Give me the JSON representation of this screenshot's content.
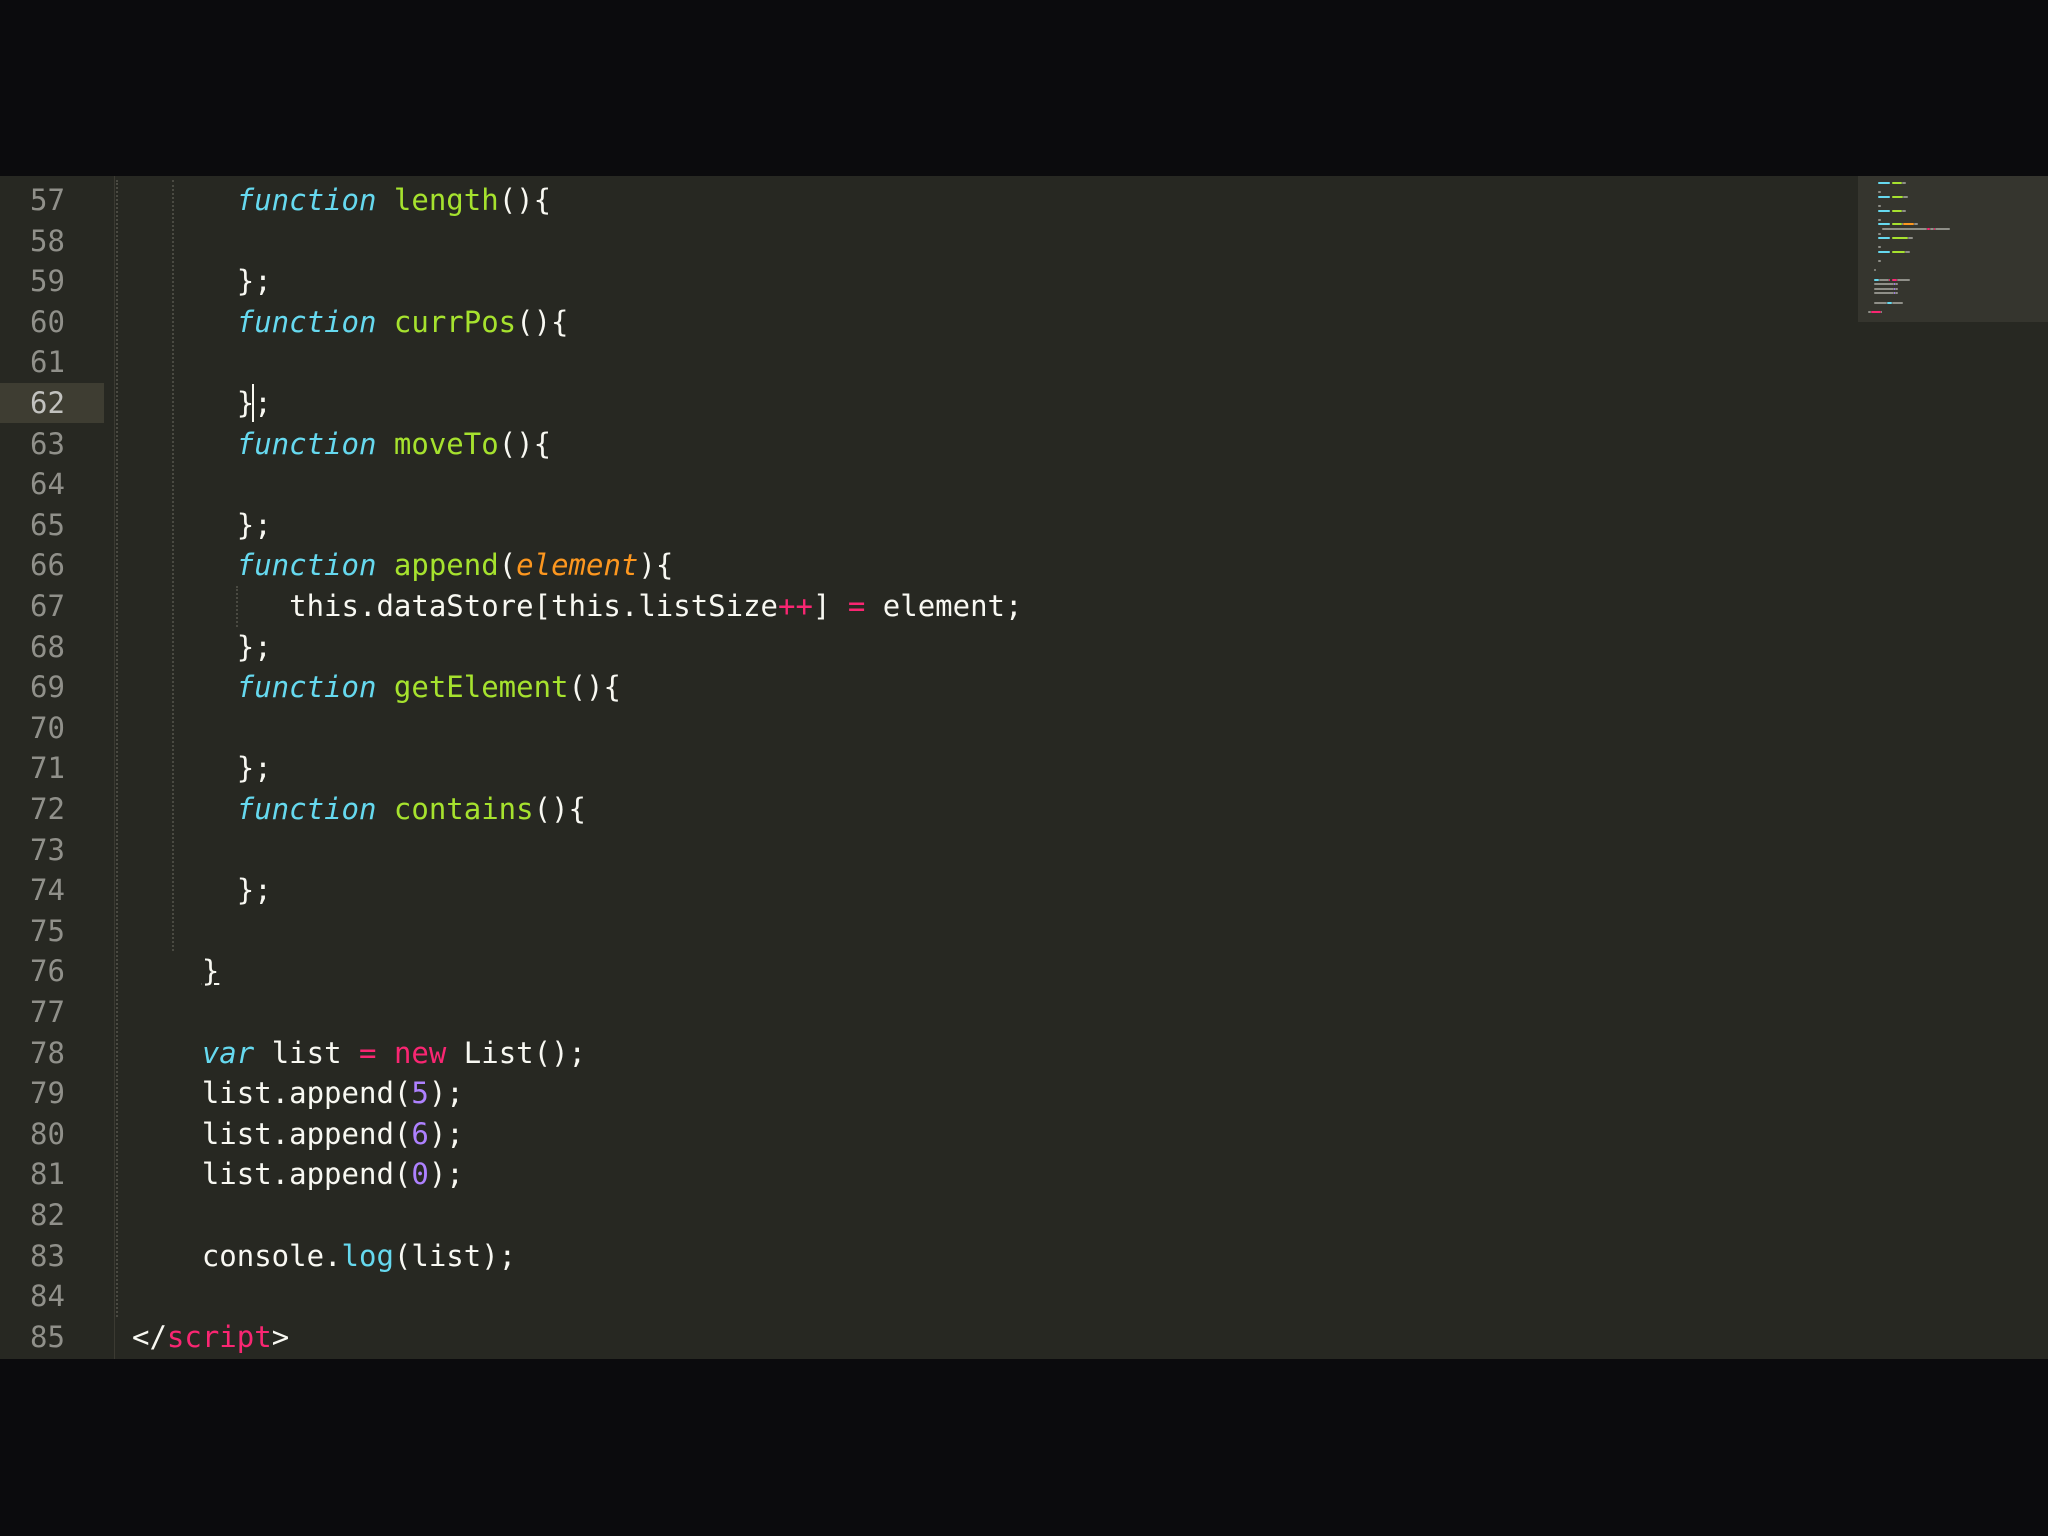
{
  "app": {
    "name": "code-editor",
    "language": "javascript"
  },
  "theme": {
    "background": "#272822",
    "foreground": "#f8f8f2",
    "keyword": "#66d9ef",
    "function": "#a6e22e",
    "parameter": "#fd971f",
    "operator": "#f92672",
    "number": "#ae81ff",
    "gutter_text": "#90908a",
    "active_line": "#3e3d32"
  },
  "editor": {
    "active_line_number": "62",
    "lines": [
      {
        "number": "57",
        "indent": "      ",
        "tokens": [
          {
            "t": "function",
            "c": "kw-storage"
          },
          {
            "t": " ",
            "c": "punct"
          },
          {
            "t": "length",
            "c": "fn-name"
          },
          {
            "t": "(){",
            "c": "punct"
          }
        ]
      },
      {
        "number": "58",
        "indent": "",
        "tokens": []
      },
      {
        "number": "59",
        "indent": "      ",
        "tokens": [
          {
            "t": "};",
            "c": "punct"
          }
        ]
      },
      {
        "number": "60",
        "indent": "      ",
        "tokens": [
          {
            "t": "function",
            "c": "kw-storage"
          },
          {
            "t": " ",
            "c": "punct"
          },
          {
            "t": "currPos",
            "c": "fn-name"
          },
          {
            "t": "(){",
            "c": "punct"
          }
        ]
      },
      {
        "number": "61",
        "indent": "",
        "tokens": []
      },
      {
        "number": "62",
        "indent": "      ",
        "tokens": [
          {
            "t": "};",
            "c": "punct"
          }
        ]
      },
      {
        "number": "63",
        "indent": "      ",
        "tokens": [
          {
            "t": "function",
            "c": "kw-storage"
          },
          {
            "t": " ",
            "c": "punct"
          },
          {
            "t": "moveTo",
            "c": "fn-name"
          },
          {
            "t": "(){",
            "c": "punct"
          }
        ]
      },
      {
        "number": "64",
        "indent": "",
        "tokens": []
      },
      {
        "number": "65",
        "indent": "      ",
        "tokens": [
          {
            "t": "};",
            "c": "punct"
          }
        ]
      },
      {
        "number": "66",
        "indent": "      ",
        "tokens": [
          {
            "t": "function",
            "c": "kw-storage"
          },
          {
            "t": " ",
            "c": "punct"
          },
          {
            "t": "append",
            "c": "fn-name"
          },
          {
            "t": "(",
            "c": "punct"
          },
          {
            "t": "element",
            "c": "param"
          },
          {
            "t": "){",
            "c": "punct"
          }
        ]
      },
      {
        "number": "67",
        "indent": "         ",
        "tokens": [
          {
            "t": "this.dataStore[this.listSize",
            "c": "punct"
          },
          {
            "t": "++",
            "c": "op"
          },
          {
            "t": "] ",
            "c": "punct"
          },
          {
            "t": "=",
            "c": "op"
          },
          {
            "t": " element;",
            "c": "punct"
          }
        ]
      },
      {
        "number": "68",
        "indent": "      ",
        "tokens": [
          {
            "t": "};",
            "c": "punct"
          }
        ]
      },
      {
        "number": "69",
        "indent": "      ",
        "tokens": [
          {
            "t": "function",
            "c": "kw-storage"
          },
          {
            "t": " ",
            "c": "punct"
          },
          {
            "t": "getElement",
            "c": "fn-name"
          },
          {
            "t": "(){",
            "c": "punct"
          }
        ]
      },
      {
        "number": "70",
        "indent": "",
        "tokens": []
      },
      {
        "number": "71",
        "indent": "      ",
        "tokens": [
          {
            "t": "};",
            "c": "punct"
          }
        ]
      },
      {
        "number": "72",
        "indent": "      ",
        "tokens": [
          {
            "t": "function",
            "c": "kw-storage"
          },
          {
            "t": " ",
            "c": "punct"
          },
          {
            "t": "contains",
            "c": "fn-name"
          },
          {
            "t": "(){",
            "c": "punct"
          }
        ]
      },
      {
        "number": "73",
        "indent": "",
        "tokens": []
      },
      {
        "number": "74",
        "indent": "      ",
        "tokens": [
          {
            "t": "};",
            "c": "punct"
          }
        ]
      },
      {
        "number": "75",
        "indent": "",
        "tokens": []
      },
      {
        "number": "76",
        "indent": "    ",
        "tokens": [
          {
            "t": "}",
            "c": "punct underline"
          }
        ]
      },
      {
        "number": "77",
        "indent": "",
        "tokens": []
      },
      {
        "number": "78",
        "indent": "    ",
        "tokens": [
          {
            "t": "var",
            "c": "kw-storage"
          },
          {
            "t": " list ",
            "c": "punct"
          },
          {
            "t": "=",
            "c": "op"
          },
          {
            "t": " ",
            "c": "punct"
          },
          {
            "t": "new",
            "c": "op"
          },
          {
            "t": " List();",
            "c": "punct"
          }
        ]
      },
      {
        "number": "79",
        "indent": "    ",
        "tokens": [
          {
            "t": "list.append(",
            "c": "punct"
          },
          {
            "t": "5",
            "c": "num"
          },
          {
            "t": ");",
            "c": "punct"
          }
        ]
      },
      {
        "number": "80",
        "indent": "    ",
        "tokens": [
          {
            "t": "list.append(",
            "c": "punct"
          },
          {
            "t": "6",
            "c": "num"
          },
          {
            "t": ");",
            "c": "punct"
          }
        ]
      },
      {
        "number": "81",
        "indent": "    ",
        "tokens": [
          {
            "t": "list.append(",
            "c": "punct"
          },
          {
            "t": "0",
            "c": "num"
          },
          {
            "t": ");",
            "c": "punct"
          }
        ]
      },
      {
        "number": "82",
        "indent": "",
        "tokens": []
      },
      {
        "number": "83",
        "indent": "    ",
        "tokens": [
          {
            "t": "console.",
            "c": "punct"
          },
          {
            "t": "log",
            "c": "support"
          },
          {
            "t": "(list);",
            "c": "punct"
          }
        ]
      },
      {
        "number": "84",
        "indent": "",
        "tokens": []
      },
      {
        "number": "85",
        "indent": "",
        "tokens": [
          {
            "t": "</",
            "c": "punct"
          },
          {
            "t": "script",
            "c": "tag-name"
          },
          {
            "t": ">",
            "c": "punct"
          }
        ]
      }
    ]
  }
}
